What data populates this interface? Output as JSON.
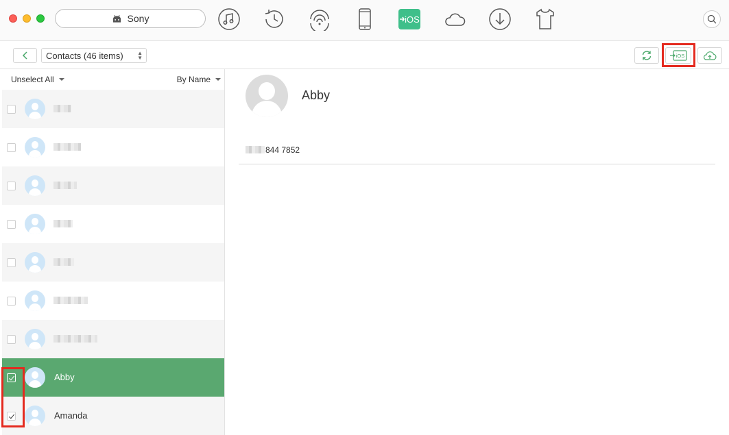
{
  "titlebar": {
    "device_name": "Sony",
    "toolbar_icons": [
      "music-icon",
      "history-icon",
      "wifi-sync-icon",
      "phone-icon",
      "to-ios-icon",
      "cloud-icon",
      "download-icon",
      "tshirt-icon"
    ],
    "to_ios_label": "iOS",
    "accent_color": "#3fbf8a"
  },
  "subbar": {
    "category_label": "Contacts (46 items)",
    "to_ios_button_label": "iOS"
  },
  "list": {
    "unselect_all_label": "Unselect All",
    "sort_label": "By Name",
    "rows": [
      {
        "name": "",
        "checked": false,
        "selected": false
      },
      {
        "name": "",
        "checked": false,
        "selected": false
      },
      {
        "name": "",
        "checked": false,
        "selected": false
      },
      {
        "name": "",
        "checked": false,
        "selected": false
      },
      {
        "name": "",
        "checked": false,
        "selected": false
      },
      {
        "name": "",
        "checked": false,
        "selected": false
      },
      {
        "name": "",
        "checked": false,
        "selected": false
      },
      {
        "name": "Abby",
        "checked": true,
        "selected": true
      },
      {
        "name": "Amanda",
        "checked": true,
        "selected": false
      }
    ]
  },
  "detail": {
    "name": "Abby",
    "phone_visible": "844 7852"
  }
}
